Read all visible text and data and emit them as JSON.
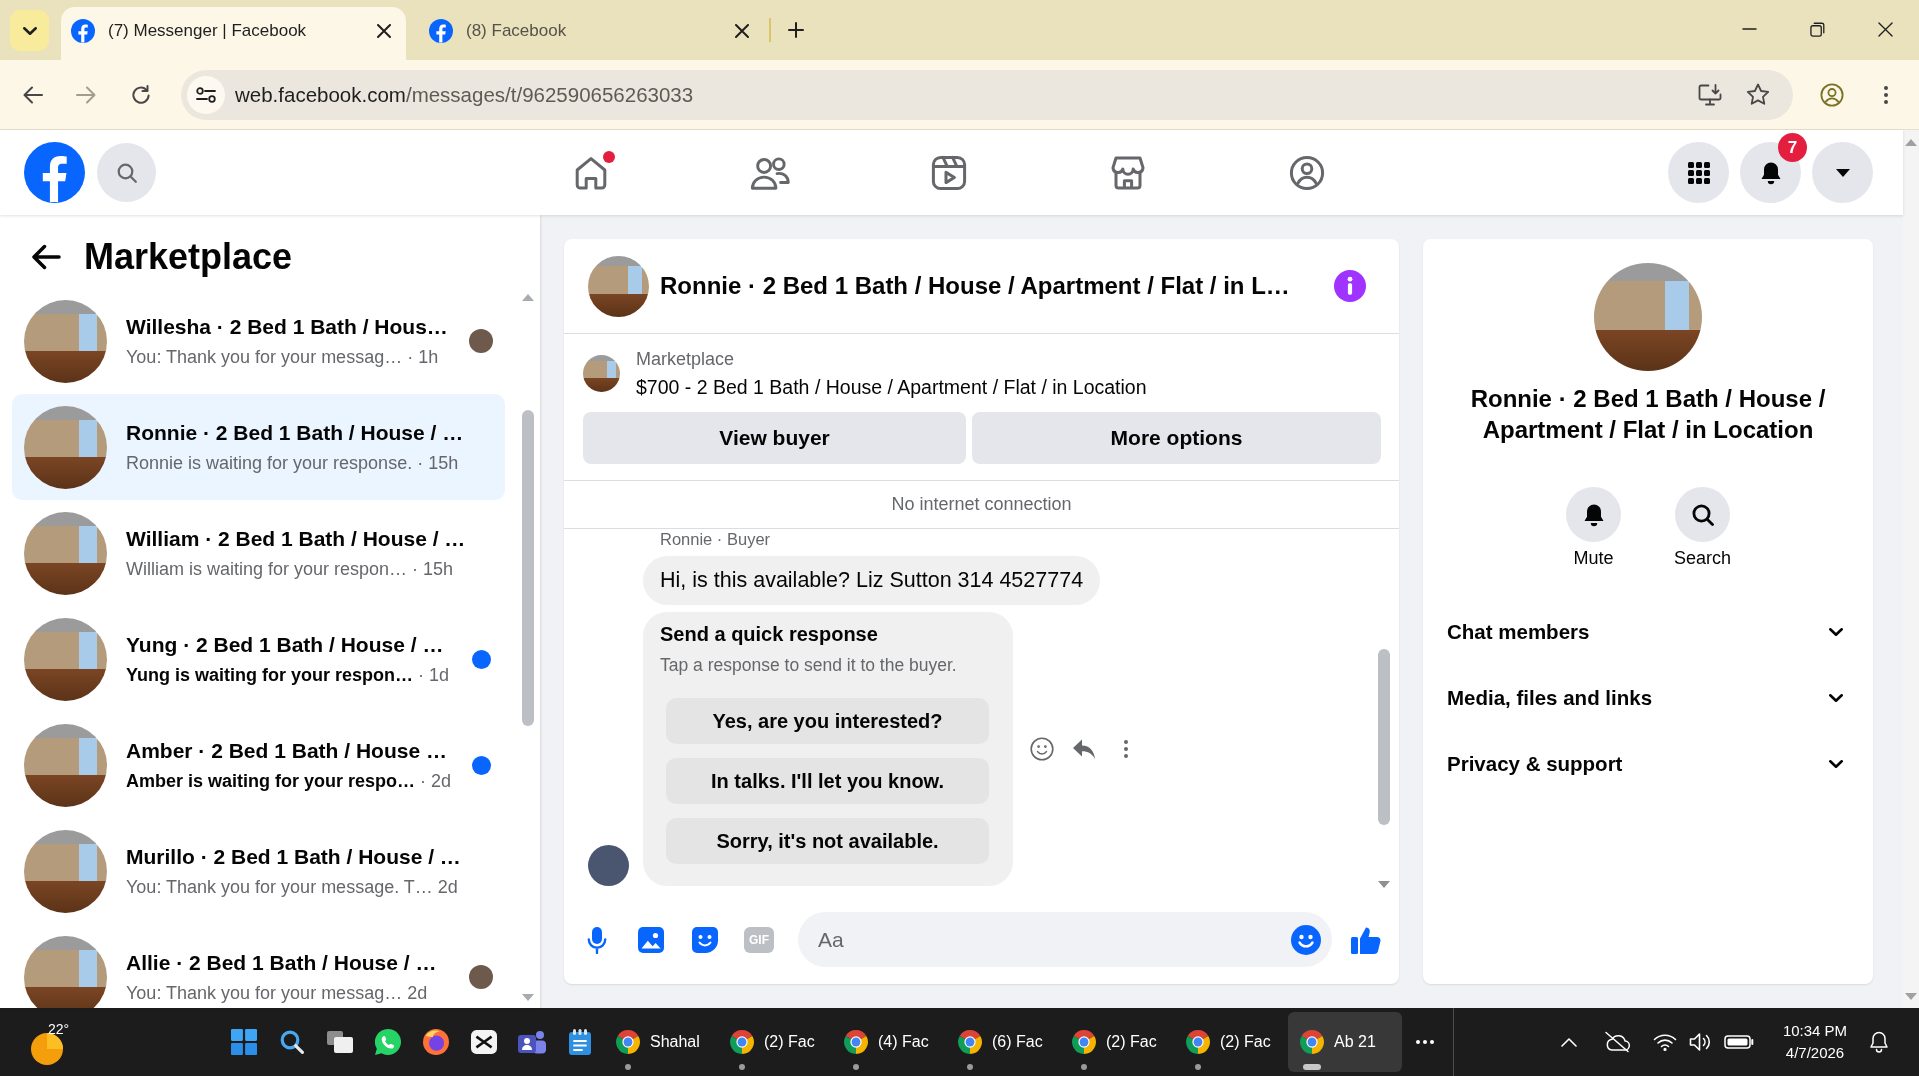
{
  "browser": {
    "tabs": [
      {
        "title": "(7) Messenger | Facebook",
        "selected": true
      },
      {
        "title": "(8) Facebook",
        "selected": false
      }
    ],
    "url": {
      "host": "web.facebook.com",
      "path": "/messages/t/962590656263033"
    }
  },
  "header": {
    "nav": [
      {
        "kind": "home",
        "dot": true
      },
      {
        "kind": "friends",
        "dot": false
      },
      {
        "kind": "video",
        "dot": false
      },
      {
        "kind": "marketplace",
        "dot": false
      },
      {
        "kind": "groups",
        "dot": false
      }
    ],
    "notifications": "7"
  },
  "sidebar": {
    "title": "Marketplace",
    "conversations": [
      {
        "name": "Willesha · 2 Bed 1 Bath / Hous…",
        "preview": "You: Thank you for your messag…",
        "time": "· 1h",
        "selected": false,
        "unread": false,
        "seen": true
      },
      {
        "name": "Ronnie · 2 Bed 1 Bath / House / …",
        "preview": "Ronnie is waiting for your response.",
        "time": "· 15h",
        "selected": true,
        "unread": false,
        "seen": false
      },
      {
        "name": "William · 2 Bed 1 Bath / House / …",
        "preview": "William is waiting for your respon…",
        "time": "· 15h",
        "selected": false,
        "unread": false,
        "seen": false
      },
      {
        "name": "Yung · 2 Bed 1 Bath / House / …",
        "preview": "Yung is waiting for your respon…",
        "time": "· 1d",
        "selected": false,
        "unread": true,
        "seen": false
      },
      {
        "name": "Amber · 2 Bed 1 Bath / House …",
        "preview": "Amber is waiting for your respo…",
        "time": "· 2d",
        "selected": false,
        "unread": true,
        "seen": false
      },
      {
        "name": "Murillo · 2 Bed 1 Bath / House / …",
        "preview": "You: Thank you for your message. T…",
        "time": "2d",
        "selected": false,
        "unread": false,
        "seen": false
      },
      {
        "name": "Allie · 2 Bed 1 Bath / House / …",
        "preview": "You: Thank you for your messag…",
        "time": "2d",
        "selected": false,
        "unread": false,
        "seen": true
      }
    ]
  },
  "chat": {
    "title": "Ronnie · 2 Bed 1 Bath / House / Apartment / Flat / in L…",
    "listing": {
      "label": "Marketplace",
      "text": "$700 - 2 Bed 1 Bath / House / Apartment / Flat / in Location"
    },
    "actions": [
      "View buyer",
      "More options"
    ],
    "status": "No internet connection",
    "sender": "Ronnie · Buyer",
    "message": "Hi, is this available? Liz Sutton 314 4527774",
    "quick_response": {
      "title": "Send a quick response",
      "hint": "Tap a response to send it to the buyer.",
      "options": [
        "Yes, are you interested?",
        "In talks. I'll let you know.",
        "Sorry, it's not available."
      ]
    },
    "composer": {
      "gif": "GIF",
      "placeholder": "Aa"
    }
  },
  "details": {
    "title": "Ronnie · 2 Bed 1 Bath / House / Apartment / Flat / in Location",
    "actions": [
      {
        "kind": "mute",
        "label": "Mute"
      },
      {
        "kind": "search",
        "label": "Search"
      }
    ],
    "sections": [
      {
        "label": "Chat members",
        "expanded": false
      },
      {
        "label": "Media, files and links",
        "expanded": false
      },
      {
        "label": "Privacy & support",
        "expanded": false
      }
    ]
  },
  "taskbar": {
    "weather": "22°",
    "pinned": [
      {
        "kind": "start"
      },
      {
        "kind": "search"
      },
      {
        "kind": "task-view"
      },
      {
        "kind": "whatsapp"
      },
      {
        "kind": "firefox"
      },
      {
        "kind": "capcut"
      },
      {
        "kind": "teams"
      },
      {
        "kind": "notepad"
      }
    ],
    "windows": [
      {
        "label": "Shahal",
        "selected": false
      },
      {
        "label": "(2) Fac",
        "selected": false
      },
      {
        "label": "(4) Fac",
        "selected": false
      },
      {
        "label": "(6) Fac",
        "selected": false
      },
      {
        "label": "(2) Fac",
        "selected": false
      },
      {
        "label": "(2) Fac",
        "selected": false
      },
      {
        "label": "Ab 21",
        "selected": true
      }
    ],
    "time": "10:34 PM",
    "date": "4/7/2026"
  }
}
